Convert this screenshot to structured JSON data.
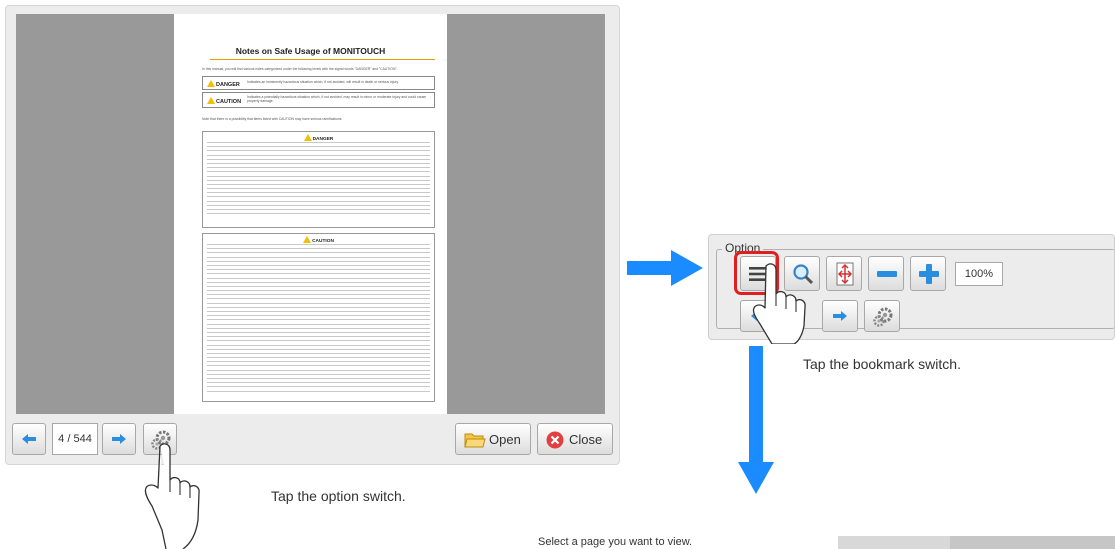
{
  "viewer": {
    "document": {
      "title": "Notes on Safe Usage of MONITOUCH",
      "intro": "In this manual, you will find various notes categorized under the following levels with the signal words \"DANGER\" and \"CAUTION\".",
      "danger_label": "DANGER",
      "danger_text": "Indicates an imminently hazardous situation which, if not avoided, will result in death or serious injury.",
      "caution_label": "CAUTION",
      "caution_text": "Indicates a potentially hazardous situation which, if not avoided, may result in minor or moderate injury and could cause property damage.",
      "note": "Note that there is a possibility that items listed with CAUTION may have serious ramifications.",
      "danger_section_title": "DANGER",
      "caution_section_title": "CAUTION"
    },
    "page_indicator": "4 / 544",
    "open_label": "Open",
    "close_label": "Close"
  },
  "captions": {
    "option": "Tap the option switch.",
    "bookmark": "Tap the bookmark switch."
  },
  "option_panel": {
    "legend": "Option",
    "zoom_value": "100%"
  },
  "bottom_panel": {
    "prompt": "Select a page you want to view."
  },
  "colors": {
    "accent_arrow": "#1a8cff",
    "highlight": "#e02020",
    "nav_arrow": "#2a8ee0"
  }
}
